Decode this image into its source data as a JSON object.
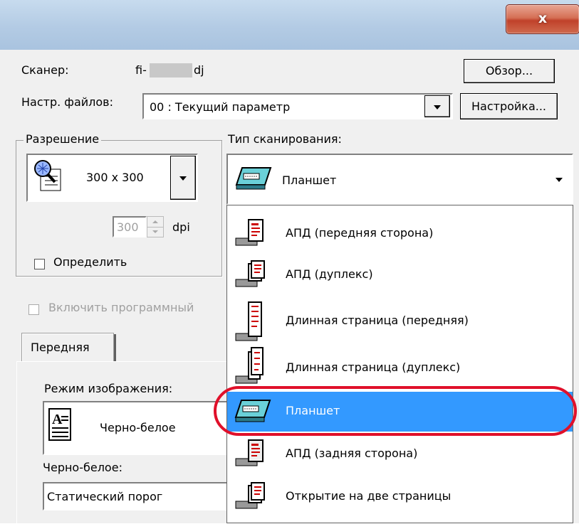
{
  "window": {
    "close_label": "x"
  },
  "scanner": {
    "label": "Сканер:",
    "model_prefix": "fi-",
    "model_suffix": "dj",
    "browse_button": "Обзор..."
  },
  "file_settings": {
    "label": "Настр. файлов:",
    "value": "00 : Текущий параметр",
    "setup_button": "Настройка..."
  },
  "resolution": {
    "group_title": "Разрешение",
    "value": "300 x 300",
    "custom_value": "300",
    "unit": "dpi",
    "detect_label": "Определить"
  },
  "scan_type": {
    "label": "Тип сканирования:",
    "selected": "Планшет",
    "options": [
      "АПД (передняя сторона)",
      "АПД (дуплекс)",
      "Длинная страница (передняя)",
      "Длинная страница (дуплекс)",
      "Планшет",
      "АПД (задняя сторона)",
      "Открытие на две страницы"
    ]
  },
  "software_option": {
    "label": "Включить программный"
  },
  "tabs": {
    "front": "Передняя"
  },
  "image_mode": {
    "label": "Режим изображения:",
    "value": "Черно-белое"
  },
  "bw": {
    "label": "Черно-белое:",
    "value": "Статический порог"
  },
  "colors": {
    "selection": "#3399ff",
    "highlight_ring": "#e0102a",
    "close_button": "#c9503a"
  }
}
